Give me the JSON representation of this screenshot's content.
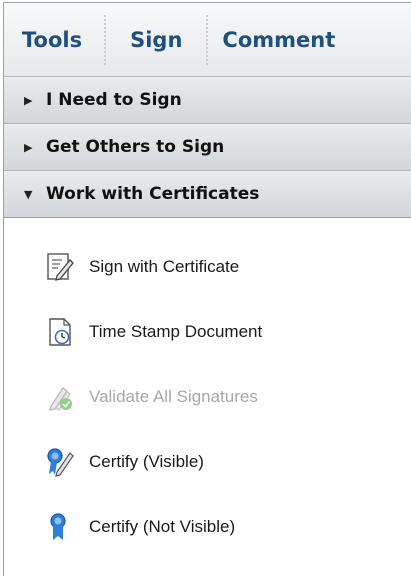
{
  "tabs": [
    {
      "label": "Tools"
    },
    {
      "label": "Sign"
    },
    {
      "label": "Comment"
    }
  ],
  "sections": [
    {
      "label": "I Need to Sign",
      "expanded": false
    },
    {
      "label": "Get Others to Sign",
      "expanded": false
    },
    {
      "label": "Work with Certificates",
      "expanded": true
    }
  ],
  "caret_collapsed": "▶",
  "caret_expanded": "▼",
  "certificate_items": [
    {
      "label": "Sign with Certificate",
      "icon": "sign-certificate-icon",
      "enabled": true
    },
    {
      "label": "Time Stamp Document",
      "icon": "time-stamp-icon",
      "enabled": true
    },
    {
      "label": "Validate All Signatures",
      "icon": "validate-signatures-icon",
      "enabled": false
    },
    {
      "label": "Certify (Visible)",
      "icon": "certify-visible-icon",
      "enabled": true
    },
    {
      "label": "Certify (Not Visible)",
      "icon": "certify-not-visible-icon",
      "enabled": true
    }
  ],
  "colors": {
    "tab_text": "#1f4f7d",
    "disabled_text": "#a7a7a7",
    "ribbon_blue": "#2f7fd6",
    "check_green": "#5bb04a"
  }
}
